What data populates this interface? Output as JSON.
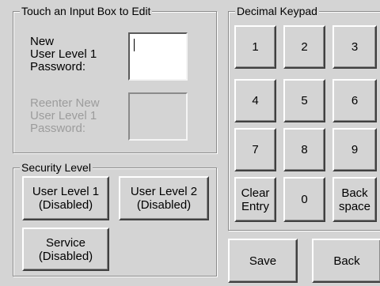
{
  "password_panel": {
    "legend": "Touch an Input Box to Edit",
    "new_password_label": [
      "New",
      "User Level 1",
      "Password:"
    ],
    "new_password_value": "",
    "reenter_password_label": [
      "Reenter New",
      "User Level 1",
      "Password:"
    ],
    "reenter_password_value": ""
  },
  "security_panel": {
    "legend": "Security Level",
    "buttons": [
      {
        "line1": "User Level 1",
        "line2": "(Disabled)"
      },
      {
        "line1": "User Level 2",
        "line2": "(Disabled)"
      },
      {
        "line1": "Service",
        "line2": "(Disabled)"
      }
    ]
  },
  "keypad": {
    "legend": "Decimal Keypad",
    "keys": [
      [
        "1"
      ],
      [
        "2"
      ],
      [
        "3"
      ],
      [
        "4"
      ],
      [
        "5"
      ],
      [
        "6"
      ],
      [
        "7"
      ],
      [
        "8"
      ],
      [
        "9"
      ],
      [
        "Clear",
        "Entry"
      ],
      [
        "0"
      ],
      [
        "Back",
        "space"
      ]
    ]
  },
  "footer": {
    "save_label": "Save",
    "back_label": "Back"
  }
}
